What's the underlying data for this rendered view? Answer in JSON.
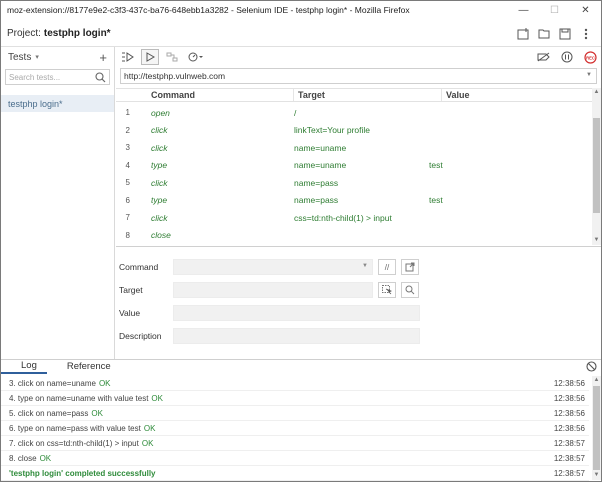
{
  "window": {
    "title": "moz-extension://8177e9e2-c3f3-437c-ba76-648ebb1a3282 - Selenium IDE - testphp login* - Mozilla Firefox",
    "minimize": "—",
    "maximize": "☐",
    "close": "✕"
  },
  "project": {
    "label": "Project:",
    "name": "testphp login*"
  },
  "sidebar": {
    "tests_label": "Tests",
    "add_label": "+",
    "search_placeholder": "Search tests...",
    "tests": [
      {
        "name": "testphp login*"
      }
    ]
  },
  "url": {
    "value": "http://testphp.vulnweb.com"
  },
  "table": {
    "headers": {
      "command": "Command",
      "target": "Target",
      "value": "Value"
    },
    "rows": [
      {
        "num": "1",
        "command": "open",
        "target": "/",
        "value": ""
      },
      {
        "num": "2",
        "command": "click",
        "target": "linkText=Your profile",
        "value": ""
      },
      {
        "num": "3",
        "command": "click",
        "target": "name=uname",
        "value": ""
      },
      {
        "num": "4",
        "command": "type",
        "target": "name=uname",
        "value": "test"
      },
      {
        "num": "5",
        "command": "click",
        "target": "name=pass",
        "value": ""
      },
      {
        "num": "6",
        "command": "type",
        "target": "name=pass",
        "value": "test"
      },
      {
        "num": "7",
        "command": "click",
        "target": "css=td:nth-child(1) > input",
        "value": ""
      },
      {
        "num": "8",
        "command": "close",
        "target": "",
        "value": ""
      }
    ]
  },
  "editor": {
    "command_label": "Command",
    "target_label": "Target",
    "value_label": "Value",
    "description_label": "Description",
    "comment_btn": "//"
  },
  "bottom": {
    "tabs": [
      {
        "label": "Log"
      },
      {
        "label": "Reference"
      }
    ],
    "log": [
      {
        "text": "3.  click on name=uname",
        "status": "OK",
        "time": "12:38:56"
      },
      {
        "text": "4.  type on name=uname with value test",
        "status": "OK",
        "time": "12:38:56"
      },
      {
        "text": "5.  click on name=pass",
        "status": "OK",
        "time": "12:38:56"
      },
      {
        "text": "6.  type on name=pass with value test",
        "status": "OK",
        "time": "12:38:56"
      },
      {
        "text": "7.  click on css=td:nth-child(1) > input",
        "status": "OK",
        "time": "12:38:57"
      },
      {
        "text": "8.  close",
        "status": "OK",
        "time": "12:38:57"
      },
      {
        "text": "'testphp login' completed successfully",
        "status": "",
        "time": "12:38:57"
      }
    ]
  },
  "colors": {
    "accent": "#2f5f9b",
    "ok": "#2e8b3a",
    "record": "#d32f2f"
  }
}
